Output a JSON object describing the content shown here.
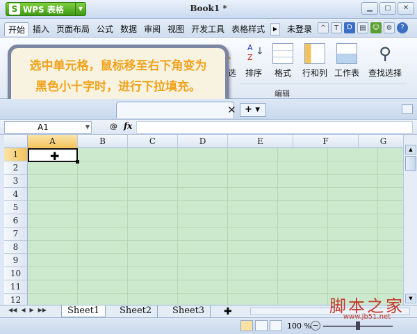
{
  "app": {
    "brand": "WPS 表格",
    "doc_title": "Book1 *"
  },
  "menu": {
    "tabs": [
      "开始",
      "插入",
      "页面布局",
      "公式",
      "数据",
      "审阅",
      "视图",
      "开发工具",
      "表格样式"
    ],
    "login": "未登录"
  },
  "ribbon": {
    "buttons": [
      "筛选",
      "排序",
      "格式",
      "行和列",
      "工作表",
      "查找选择"
    ],
    "group": "编辑"
  },
  "callout": {
    "line1": "选中单元格，鼠标移至右下角变为",
    "line2": "黑色小十字时，进行下拉填充。"
  },
  "formula": {
    "name_box": "A1",
    "fx_label": "fx",
    "value": ""
  },
  "grid": {
    "columns": [
      "A",
      "B",
      "C",
      "D",
      "E",
      "F",
      "G"
    ],
    "rows": [
      "1",
      "2",
      "3",
      "4",
      "5",
      "6",
      "7",
      "8",
      "9",
      "10",
      "11",
      "12"
    ],
    "active_cell": "A1"
  },
  "sheets": [
    "Sheet1",
    "Sheet2",
    "Sheet3"
  ],
  "status": {
    "zoom": "100 %"
  },
  "watermark": {
    "main": "脚本之家",
    "url": "www.jb51.net"
  },
  "colors": {
    "grid_bg": "#cde9cd",
    "callout_text": "#f2a21b",
    "watermark": "#c23a2a"
  }
}
